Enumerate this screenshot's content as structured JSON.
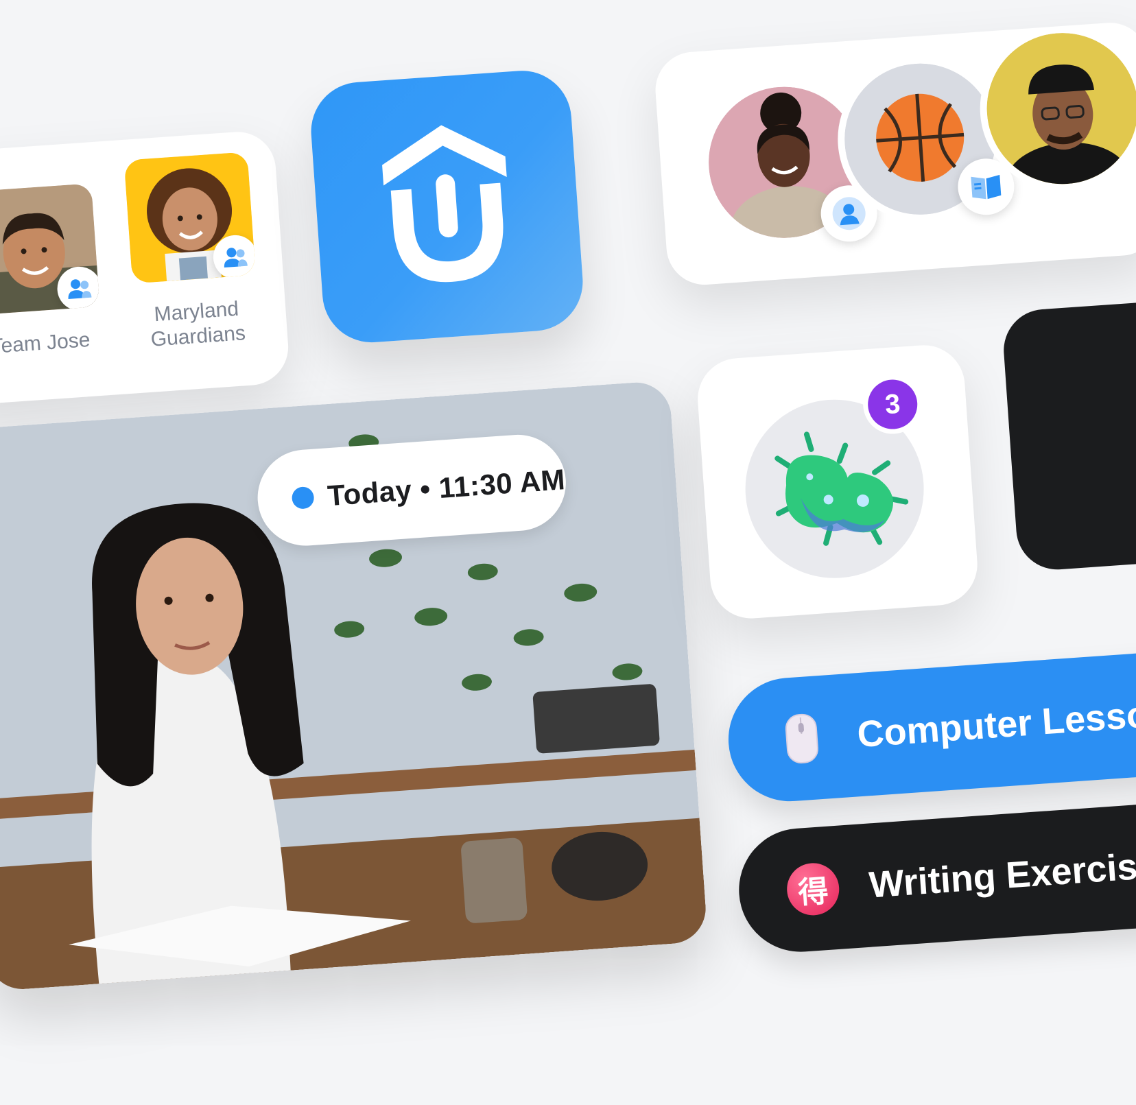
{
  "groups": [
    {
      "name": "Team Jose",
      "photo_bg": "#b69a7c"
    },
    {
      "name": "Maryland Guardians",
      "photo_bg": "#ffc414"
    }
  ],
  "app_icon": {
    "color": "#2f97f7",
    "logo_icon": "ut-logo-icon"
  },
  "avatars": [
    {
      "kind": "person",
      "bg": "#dca6b2",
      "badge_icon": "person-icon"
    },
    {
      "kind": "basketball",
      "bg": "#d8dbe2",
      "badge_icon": "book-icon"
    },
    {
      "kind": "person",
      "bg": "#e1c84e"
    }
  ],
  "session": {
    "time_label": "Today • 11:30 AM",
    "dot_color": "#2990f5"
  },
  "topic": {
    "icon": "microbe-icon",
    "count": "3",
    "badge_color": "#8a35e8"
  },
  "lessons": [
    {
      "label": "Computer Lesson",
      "icon": "mouse-icon",
      "bg": "#2b8ff3"
    },
    {
      "label": "Writing Exercise",
      "icon": "kanji-icon",
      "glyph": "得",
      "bg": "#1b1c1e"
    }
  ]
}
